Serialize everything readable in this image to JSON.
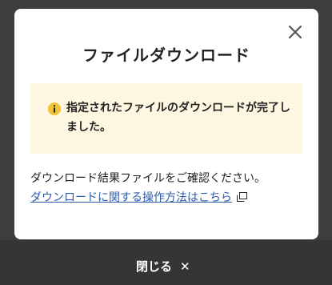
{
  "dialog": {
    "title": "ファイルダウンロード",
    "close_icon": "close-icon",
    "notice": {
      "icon": "info-icon",
      "text": "指定されたファイルのダウンロードが完了しました。",
      "background": "#fdf6e0",
      "icon_color": "#f2c230"
    },
    "body_text": "ダウンロード結果ファイルをご確認ください。",
    "help_link": {
      "label": "ダウンロードに関する操作方法はこちら",
      "icon": "external-link-icon",
      "color": "#2b5ba8"
    }
  },
  "footer": {
    "close_label": "閉じる",
    "close_icon": "✕"
  }
}
